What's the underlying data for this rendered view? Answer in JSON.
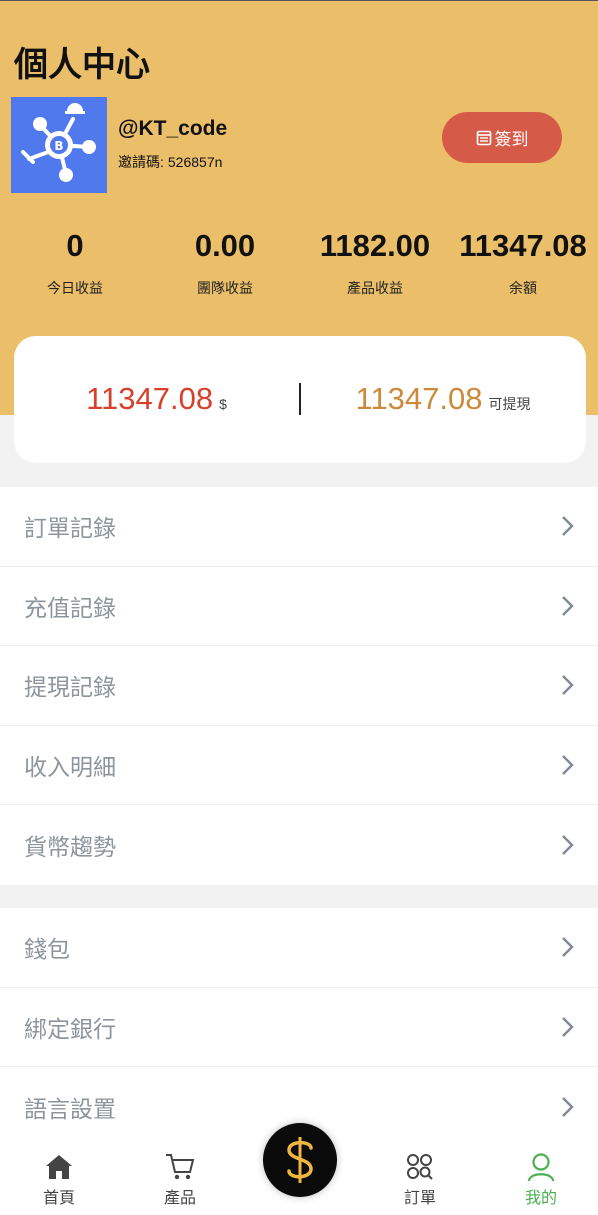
{
  "page": {
    "title": "個人中心"
  },
  "profile": {
    "username": "@KT_code",
    "invite_label": "邀請碼:",
    "invite_code": "526857n",
    "avatar_icon": "bitcoin-network-icon"
  },
  "signin": {
    "label": "簽到",
    "icon": "calendar-icon"
  },
  "stats": [
    {
      "value": "0",
      "label": "今日收益"
    },
    {
      "value": "0.00",
      "label": "團隊收益"
    },
    {
      "value": "1182.00",
      "label": "產品收益"
    },
    {
      "value": "11347.08",
      "label": "余額"
    }
  ],
  "balance": {
    "total": "11347.08",
    "currency": "$",
    "withdrawable": "11347.08",
    "withdrawable_label": "可提現"
  },
  "menu_group_1": [
    {
      "label": "訂單記錄"
    },
    {
      "label": "充值記錄"
    },
    {
      "label": "提現記錄"
    },
    {
      "label": "收入明細"
    },
    {
      "label": "貨幣趨勢"
    }
  ],
  "menu_group_2": [
    {
      "label": "錢包"
    },
    {
      "label": "綁定銀行"
    },
    {
      "label": "語言設置"
    }
  ],
  "tabbar": {
    "home": "首頁",
    "products": "產品",
    "center_icon": "dollar-icon",
    "orders": "訂單",
    "mine": "我的"
  },
  "colors": {
    "header_bg": "#ebbe69",
    "signin_bg": "#d65a48",
    "balance_total": "#d9402b",
    "balance_withdrawable": "#cc8a3b",
    "active_tab": "#4caf50",
    "avatar_bg": "#4f79ec"
  }
}
